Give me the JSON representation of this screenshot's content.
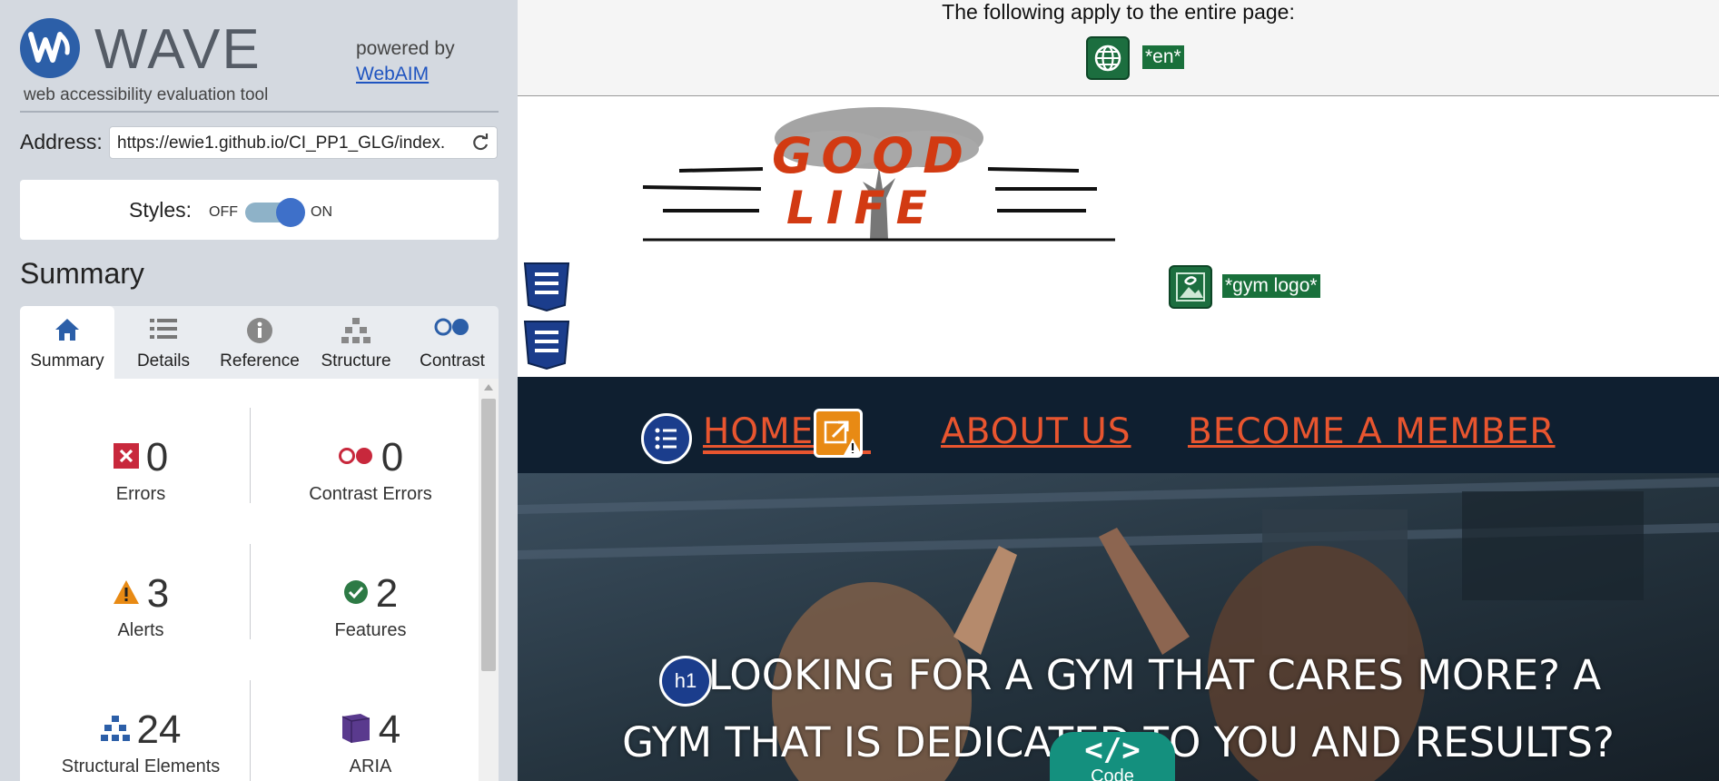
{
  "wave": {
    "logo_text": "WAVE",
    "tagline": "web accessibility evaluation tool",
    "powered_by": "powered by",
    "webaim_link": "WebAIM",
    "address_label": "Address:",
    "address_value": "https://ewie1.github.io/CI_PP1_GLG/index.",
    "styles_label": "Styles:",
    "styles_off": "OFF",
    "styles_on": "ON",
    "styles_state": "on",
    "summary_heading": "Summary",
    "tabs": [
      {
        "label": "Summary",
        "icon": "home-icon",
        "active": true
      },
      {
        "label": "Details",
        "icon": "list-icon"
      },
      {
        "label": "Reference",
        "icon": "info-icon"
      },
      {
        "label": "Structure",
        "icon": "hierarchy-icon"
      },
      {
        "label": "Contrast",
        "icon": "contrast-icon"
      }
    ],
    "stats": {
      "errors": {
        "count": "0",
        "label": "Errors"
      },
      "contrast_errors": {
        "count": "0",
        "label": "Contrast Errors"
      },
      "alerts": {
        "count": "3",
        "label": "Alerts"
      },
      "features": {
        "count": "2",
        "label": "Features"
      },
      "structural": {
        "count": "24",
        "label": "Structural Elements"
      },
      "aria": {
        "count": "4",
        "label": "ARIA"
      }
    },
    "colors": {
      "sidebar_bg": "#d4d9e0",
      "accent_blue": "#2c5fa8",
      "error_red": "#c8283c",
      "alert_orange": "#e88a14",
      "feature_green": "#2d7a45",
      "aria_purple": "#5a3a8e"
    }
  },
  "page": {
    "entire_page_msg": "The following apply to the entire page:",
    "lang_label": "*en*",
    "logo_line1": "GOOD",
    "logo_line2": "LIFE",
    "gym_logo_label": "*gym logo*",
    "nav": {
      "home": "HOME",
      "about": "ABOUT US",
      "member": "BECOME A MEMBER"
    },
    "h1_badge": "h1",
    "hero_line1": "LOOKING FOR A GYM THAT CARES MORE? A",
    "hero_line2": "GYM THAT IS DEDICATED TO YOU AND RESULTS?",
    "code_label": "Code",
    "code_symbol": "</>",
    "colors": {
      "nav_bg": "#0f1f30",
      "nav_text": "#e8552f",
      "wave_green": "#19703b"
    }
  }
}
